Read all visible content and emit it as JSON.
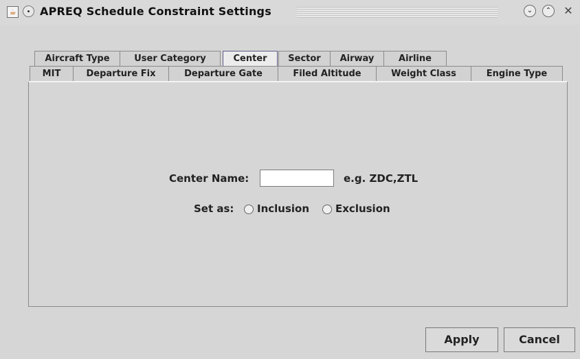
{
  "window": {
    "title": "APREQ Schedule Constraint Settings",
    "app_icon": "java-icon",
    "menu_icon": "window-menu-icon",
    "minimize_icon": "chevron-down-icon",
    "maximize_icon": "chevron-up-icon",
    "close_icon": "close-icon",
    "minimize_glyph": "⌄",
    "maximize_glyph": "⌃",
    "close_glyph": "✕"
  },
  "tabs": {
    "row1": [
      "Aircraft Type",
      "User Category",
      "Center",
      "Sector",
      "Airway",
      "Airline"
    ],
    "row2": [
      "MIT",
      "Departure Fix",
      "Departure Gate",
      "Filed Altitude",
      "Weight Class",
      "Engine Type"
    ],
    "active": "Center"
  },
  "form": {
    "center_name_label": "Center Name:",
    "center_name_value": "",
    "example_text": "e.g. ZDC,ZTL",
    "set_as_label": "Set as:",
    "inclusion_label": "Inclusion",
    "exclusion_label": "Exclusion",
    "selected": ""
  },
  "buttons": {
    "apply": "Apply",
    "cancel": "Cancel"
  }
}
